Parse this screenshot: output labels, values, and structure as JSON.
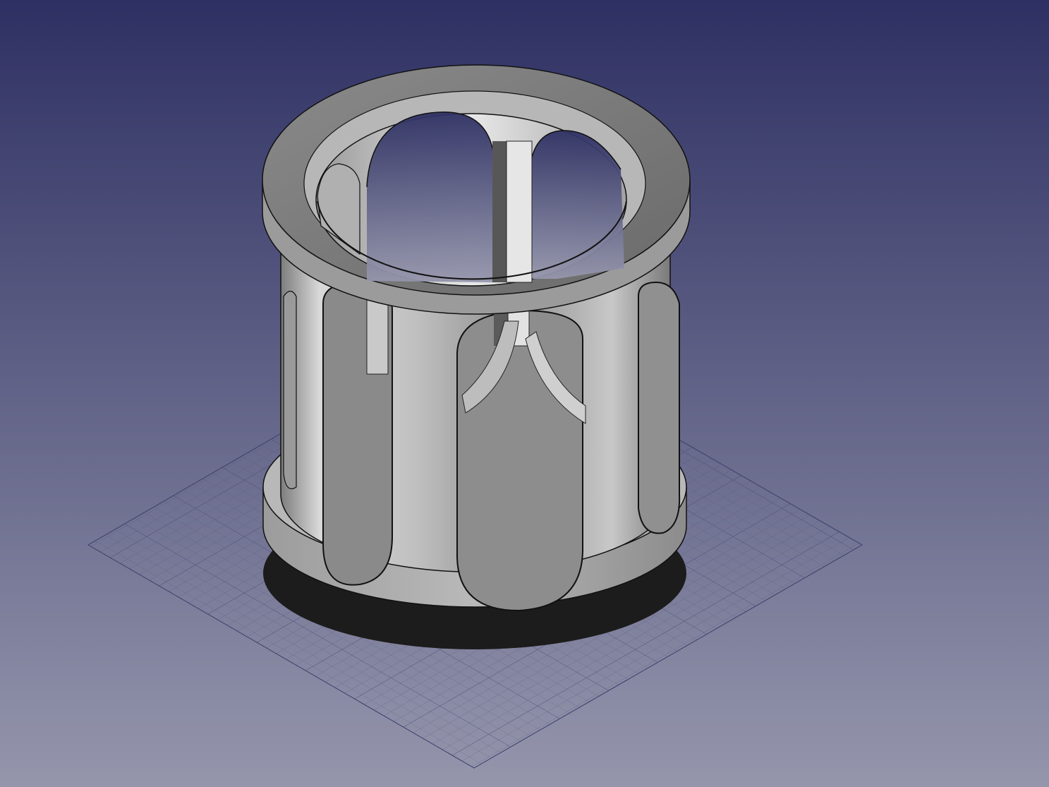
{
  "viewport": {
    "background_top": "#2e3063",
    "background_bottom": "#9596ac",
    "grid_color": "#4a4d78",
    "model_color": "#a9a9a9",
    "model_edge_color": "#000000",
    "model_shape": "cylindrical cage with oval slots on a ground-plane grid",
    "view": "isometric"
  }
}
